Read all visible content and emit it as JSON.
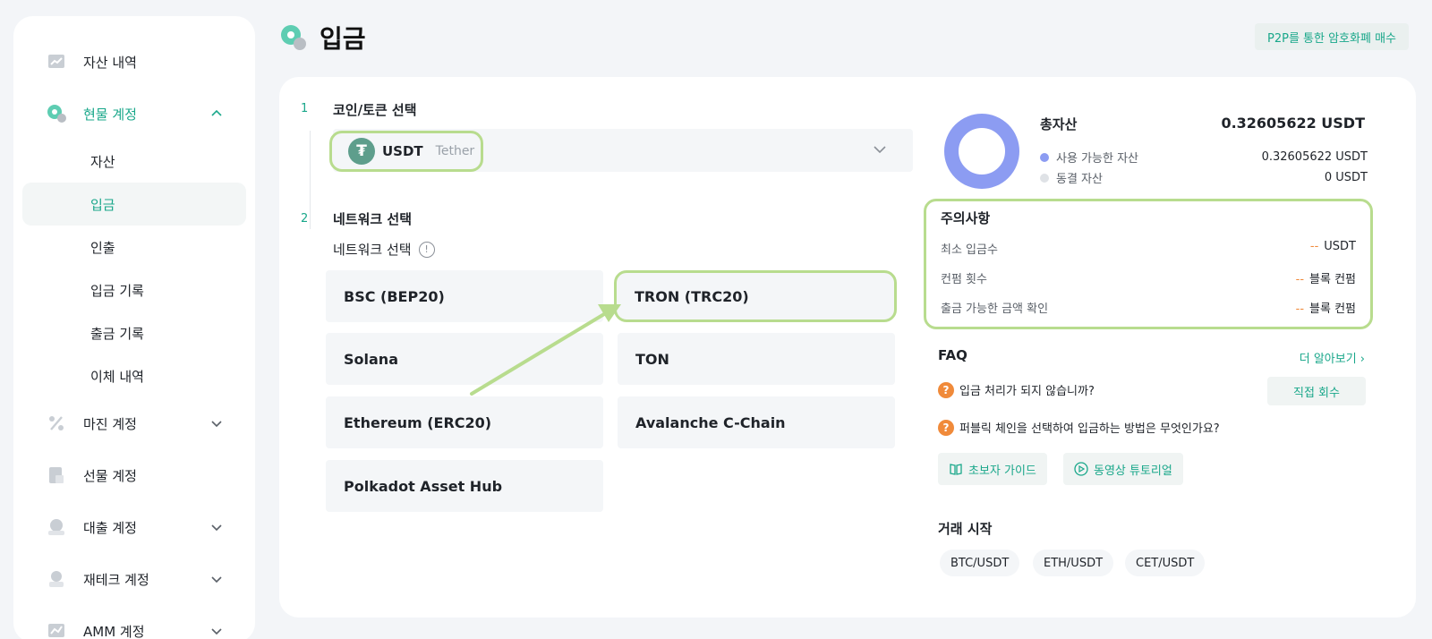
{
  "sidebar": {
    "items": [
      {
        "label": "자산 내역"
      },
      {
        "label": "현물 계정"
      },
      {
        "label": "마진 계정"
      },
      {
        "label": "선물 계정"
      },
      {
        "label": "대출 계정"
      },
      {
        "label": "재테크 계정"
      },
      {
        "label": "AMM 계정"
      }
    ],
    "sub_items": [
      {
        "label": "자산"
      },
      {
        "label": "입금"
      },
      {
        "label": "인출"
      },
      {
        "label": "입금 기록"
      },
      {
        "label": "출금 기록"
      },
      {
        "label": "이체 내역"
      }
    ]
  },
  "header": {
    "title": "입금",
    "p2p_label": "P2P를 통한 암호화폐 매수"
  },
  "step1": {
    "number": "1",
    "title": "코인/토큰 선택",
    "coin_symbol": "USDT",
    "coin_name": "Tether",
    "coin_icon": "₮"
  },
  "step2": {
    "number": "2",
    "title": "네트워크 선택",
    "subtitle": "네트워크 선택",
    "info": "!",
    "networks": [
      {
        "label": "BSC (BEP20)"
      },
      {
        "label": "TRON (TRC20)"
      },
      {
        "label": "Solana"
      },
      {
        "label": "TON"
      },
      {
        "label": "Ethereum (ERC20)"
      },
      {
        "label": "Avalanche C-Chain"
      },
      {
        "label": "Polkadot Asset Hub"
      }
    ],
    "highlighted": "TRON (TRC20)"
  },
  "assets": {
    "total_label": "총자산",
    "total_value": "0.32605622 USDT",
    "available_label": "사용 가능한 자산",
    "available_value": "0.32605622 USDT",
    "frozen_label": "동결 자산",
    "frozen_value": "0 USDT",
    "available_color": "#8c9cf2",
    "frozen_color": "#dfe2e6"
  },
  "notice": {
    "title": "주의사항",
    "rows": [
      {
        "label": "최소 입금수",
        "dash": "--",
        "value": "USDT"
      },
      {
        "label": "컨펌 횟수",
        "dash": "--",
        "value": "블록 컨펌"
      },
      {
        "label": "출금 가능한 금액 확인",
        "dash": "--",
        "value": "블록 컨펌"
      }
    ]
  },
  "faq": {
    "title": "FAQ",
    "more": "더 알아보기 ›",
    "q_icon": "?",
    "q1": "입금 처리가 되지 않습니까?",
    "direct": "직접 회수",
    "q2": "퍼블릭 체인을 선택하여 입금하는 방법은 무엇인가요?",
    "guide": "초보자 가이드",
    "video": "동영상 튜토리얼"
  },
  "trade": {
    "title": "거래 시작",
    "pairs": [
      "BTC/USDT",
      "ETH/USDT",
      "CET/USDT"
    ]
  },
  "colors": {
    "accent": "#19a78a",
    "highlight": "#b8dc8e",
    "warning": "#f08a3a"
  }
}
